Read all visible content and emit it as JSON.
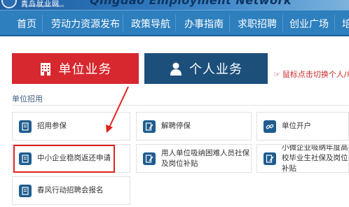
{
  "header": {
    "logo_cn": "青岛就业网",
    "logo_en": "Qingdao Employment Network",
    "banner_title": "Qingdao Employment Network"
  },
  "nav": {
    "items": [
      "首页",
      "劳动力资源发布",
      "政策导航",
      "办事指南",
      "求职招聘",
      "创业广场",
      "培"
    ]
  },
  "tabs": {
    "unit": "单位业务",
    "person": "个人业务"
  },
  "tip": "鼠标点击切换个人/单",
  "section": {
    "label": "单位招用"
  },
  "cards": [
    {
      "label": "招用参保",
      "icon": "document-icon"
    },
    {
      "label": "解聘停保",
      "icon": "document-edit-icon"
    },
    {
      "label": "单位开户",
      "icon": "link-icon"
    },
    {
      "label": "中小企业稳岗返还申请",
      "icon": "document-icon"
    },
    {
      "label": "用人单位吸纳困难人员社保及岗位补贴",
      "icon": "document-edit-icon"
    },
    {
      "label": "小微企业吸纳年度高校毕业生社保及岗位补贴",
      "icon": "document-edit-icon"
    },
    {
      "label": "春风行动招聘会报名",
      "icon": "document-icon"
    }
  ],
  "colors": {
    "nav_bg": "#2d7fbe",
    "unit_tab": "#d7282f",
    "person_tab": "#1d4f7b",
    "icon_bg": "#1f5d8f",
    "annotation_red": "#e0231f"
  }
}
